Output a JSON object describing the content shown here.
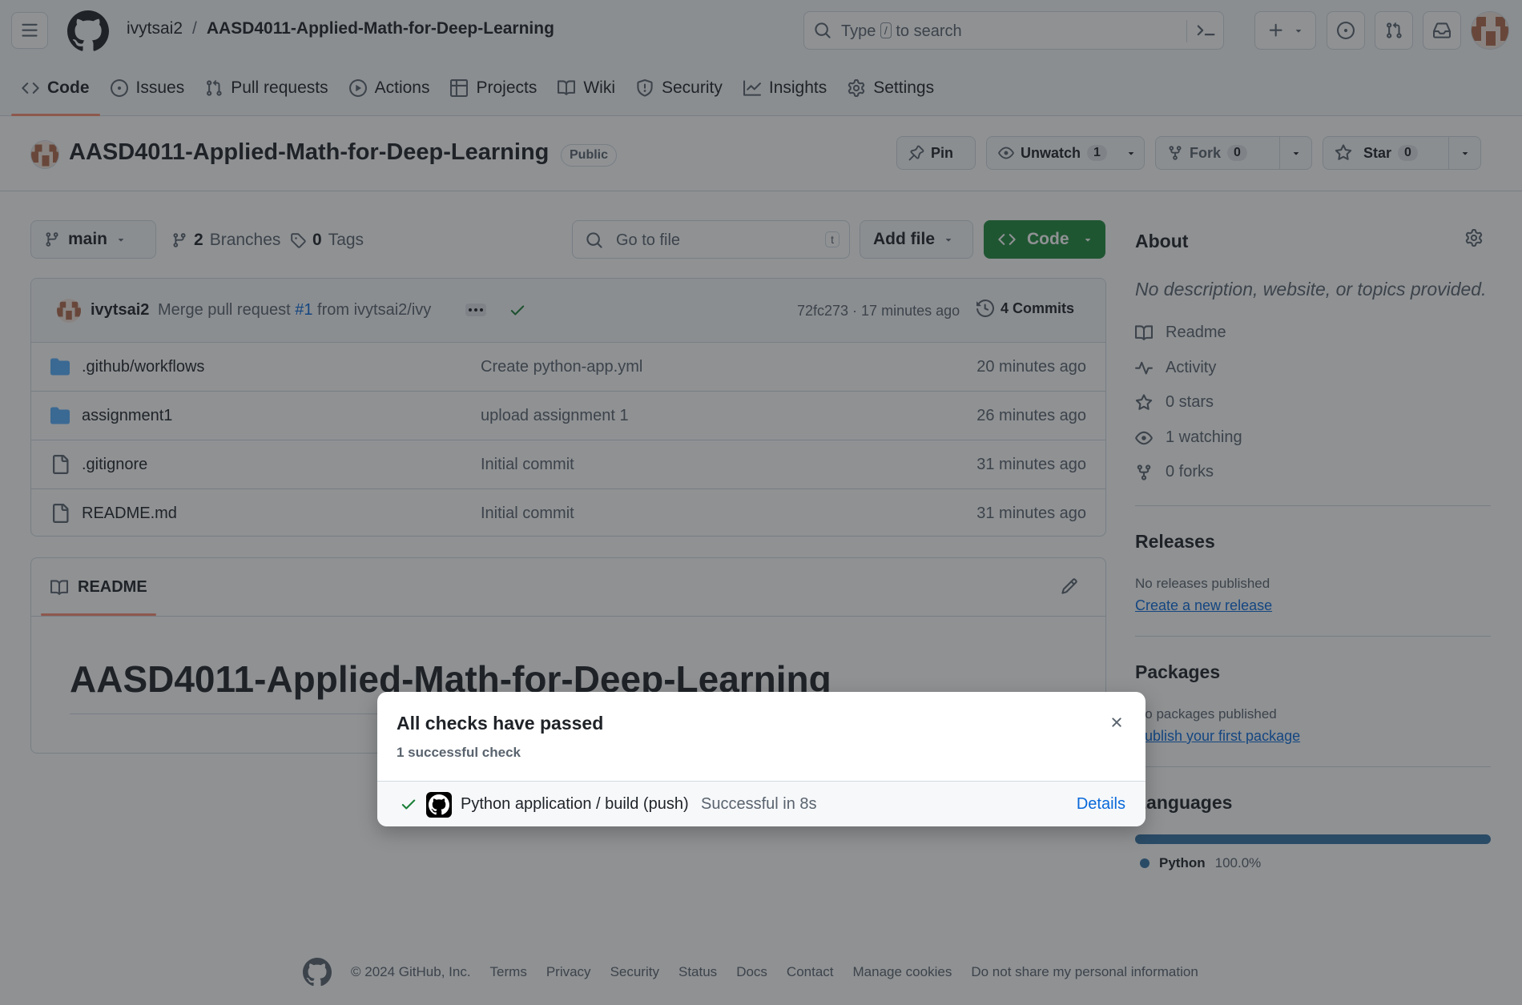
{
  "header": {
    "owner": "ivytsai2",
    "separator": "/",
    "repo": "AASD4011-Applied-Math-for-Deep-Learning",
    "search_prefix": "Type",
    "search_key": "/",
    "search_suffix": "to search"
  },
  "tabs": [
    {
      "label": "Code",
      "icon": "code-icon"
    },
    {
      "label": "Issues",
      "icon": "issue-icon"
    },
    {
      "label": "Pull requests",
      "icon": "pull-request-icon"
    },
    {
      "label": "Actions",
      "icon": "play-icon"
    },
    {
      "label": "Projects",
      "icon": "table-icon"
    },
    {
      "label": "Wiki",
      "icon": "book-icon"
    },
    {
      "label": "Security",
      "icon": "shield-icon"
    },
    {
      "label": "Insights",
      "icon": "graph-icon"
    },
    {
      "label": "Settings",
      "icon": "gear-icon"
    }
  ],
  "repo_header": {
    "title": "AASD4011-Applied-Math-for-Deep-Learning",
    "visibility": "Public",
    "pin": "Pin",
    "watch": "Unwatch",
    "watch_count": "1",
    "fork": "Fork",
    "fork_count": "0",
    "star": "Star",
    "star_count": "0"
  },
  "toolbar": {
    "branch": "main",
    "branches_count": "2",
    "branches_label": "Branches",
    "tags_count": "0",
    "tags_label": "Tags",
    "goto_placeholder": "Go to file",
    "goto_key": "t",
    "add_file": "Add file",
    "code": "Code"
  },
  "commit": {
    "user": "ivytsai2",
    "message_prefix": "Merge pull request",
    "pr": "#1",
    "message_suffix": "from ivytsai2/ivy",
    "hash_time": "72fc273 · 17 minutes ago",
    "commits": "4 Commits"
  },
  "files": [
    {
      "name": ".github/workflows",
      "type": "folder",
      "message": "Create python-app.yml",
      "time": "20 minutes ago"
    },
    {
      "name": "assignment1",
      "type": "folder",
      "message": "upload assignment 1",
      "time": "26 minutes ago"
    },
    {
      "name": ".gitignore",
      "type": "file",
      "message": "Initial commit",
      "time": "31 minutes ago"
    },
    {
      "name": "README.md",
      "type": "file",
      "message": "Initial commit",
      "time": "31 minutes ago"
    }
  ],
  "readme": {
    "tab": "README",
    "heading": "AASD4011-Applied-Math-for-Deep-Learning"
  },
  "sidebar": {
    "about": "About",
    "description": "No description, website, or topics provided.",
    "items": [
      "Readme",
      "Activity",
      "0 stars",
      "1 watching",
      "0 forks"
    ],
    "releases_title": "Releases",
    "releases_none": "No releases published",
    "releases_link": "Create a new release",
    "packages_title": "Packages",
    "packages_none": "No packages published",
    "packages_link": "Publish your first package",
    "languages_title": "Languages",
    "language": "Python",
    "language_pct": "100.0%",
    "language_color": "#3572A5",
    "language_share": 1.0
  },
  "footer": {
    "copyright": "© 2024 GitHub, Inc.",
    "links": [
      "Terms",
      "Privacy",
      "Security",
      "Status",
      "Docs",
      "Contact",
      "Manage cookies",
      "Do not share my personal information"
    ]
  },
  "modal": {
    "title": "All checks have passed",
    "subtitle": "1 successful check",
    "check_name": "Python application / build (push)",
    "check_status": "Successful in 8s",
    "details": "Details"
  },
  "colors": {
    "accent": "#0969da",
    "success": "#1a7f37",
    "code_button": "#1f883d",
    "tab_underline": "#fd8c73"
  }
}
